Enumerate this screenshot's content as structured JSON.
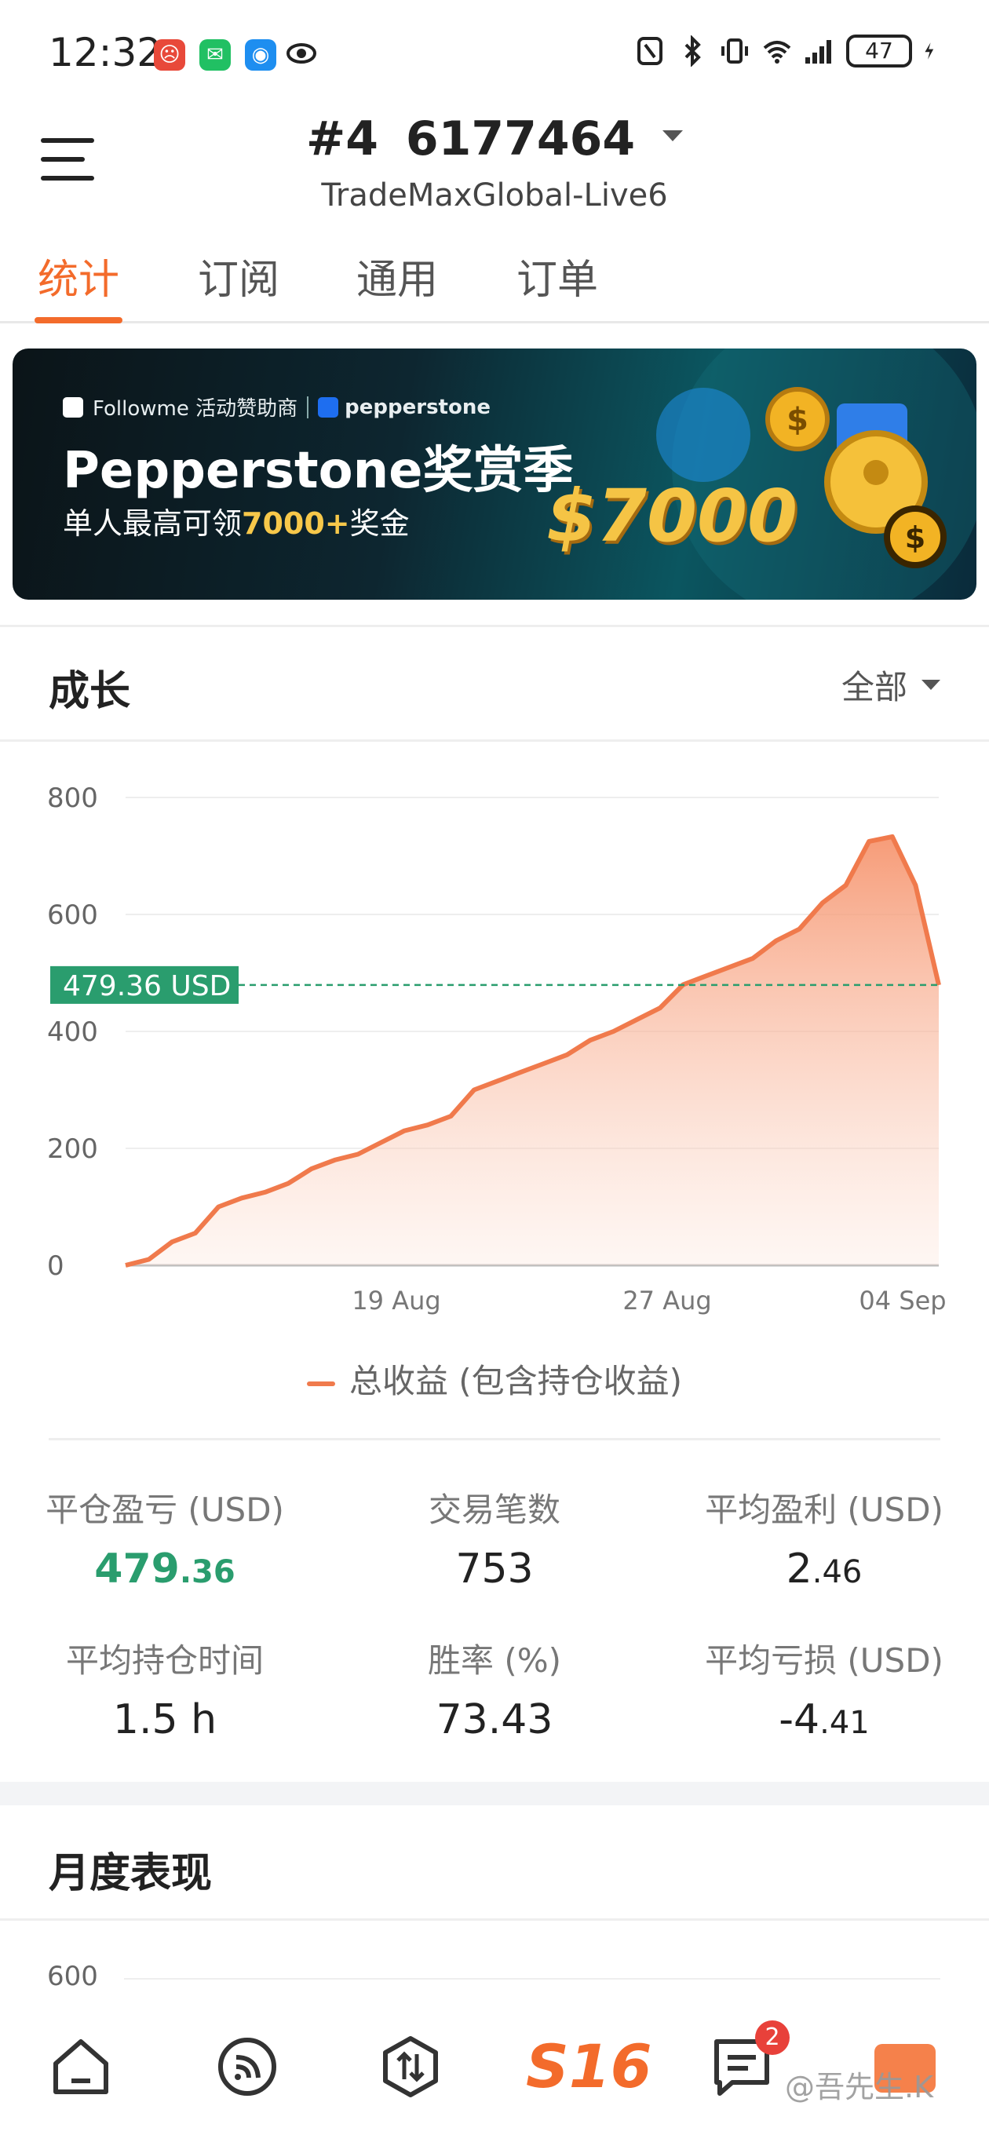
{
  "status_bar": {
    "time": "12:32",
    "battery": "47"
  },
  "header": {
    "account_prefix": "#4",
    "account_number": "6177464",
    "server": "TradeMaxGlobal-Live6"
  },
  "tabs": [
    {
      "label": "统计",
      "active": true
    },
    {
      "label": "订阅",
      "active": false
    },
    {
      "label": "通用",
      "active": false
    },
    {
      "label": "订单",
      "active": false
    }
  ],
  "banner": {
    "sponsor_line": "Followme 活动赞助商",
    "brand": "pepperstone",
    "title": "Pepperstone奖赏季",
    "subtitle_prefix": "单人最高可领",
    "subtitle_highlight": "7000+",
    "subtitle_suffix": "奖金",
    "prize": "$7000"
  },
  "growth": {
    "title": "成长",
    "range": "全部",
    "current_label": "479.36 USD",
    "legend": "总收益 (包含持仓收益)"
  },
  "chart_data": {
    "type": "area",
    "title": "",
    "xlabel": "",
    "ylabel": "",
    "ylim": [
      0,
      800
    ],
    "yticks": [
      0,
      200,
      400,
      600,
      800
    ],
    "xtick_labels": [
      "19 Aug",
      "27 Aug",
      "04 Sep"
    ],
    "reference_line": 479.36,
    "series": [
      {
        "name": "总收益 (包含持仓收益)",
        "color": "#f07a4c",
        "values": [
          0,
          10,
          40,
          55,
          100,
          115,
          125,
          140,
          165,
          180,
          190,
          210,
          230,
          240,
          255,
          300,
          315,
          330,
          345,
          360,
          385,
          400,
          420,
          440,
          480,
          495,
          510,
          525,
          555,
          575,
          620,
          650,
          725,
          733,
          650,
          479.36
        ]
      }
    ]
  },
  "stats": [
    {
      "label": "平仓盈亏 (USD)",
      "int": "479",
      "dec": ".36",
      "green": true
    },
    {
      "label": "交易笔数",
      "int": "753",
      "dec": "",
      "green": false
    },
    {
      "label": "平均盈利 (USD)",
      "int": "2",
      "dec": ".46",
      "green": false
    },
    {
      "label": "平均持仓时间",
      "int": "1.5 h",
      "dec": "",
      "green": false
    },
    {
      "label": "胜率 (%)",
      "int": "73.43",
      "dec": "",
      "green": false
    },
    {
      "label": "平均亏损 (USD)",
      "int": "-4",
      "dec": ".41",
      "green": false
    }
  ],
  "monthly": {
    "title": "月度表现",
    "first_tick": "600"
  },
  "bottom_nav": {
    "logo": "S16",
    "badge": "2",
    "watermark": "@吾先生.K"
  },
  "colors": {
    "accent": "#f36b2b",
    "positive": "#2a9d6e",
    "line": "#f07a4c"
  }
}
